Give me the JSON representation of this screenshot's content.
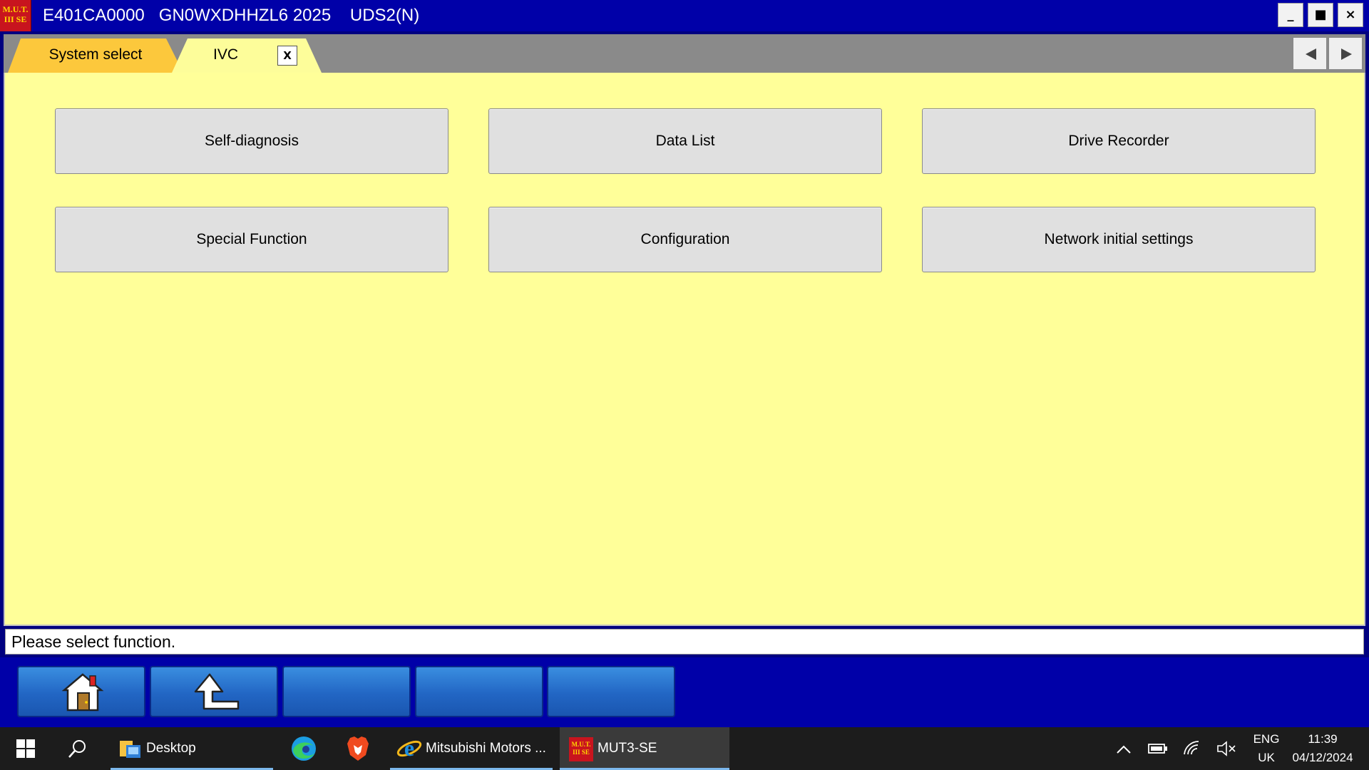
{
  "window": {
    "logo_text": "M.U.T.\nIII SE",
    "title": "E401CA0000   GN0WXDHHZL6 2025    UDS2(N)",
    "minimize_label": "_",
    "maximize_label": "■",
    "close_label": "×"
  },
  "tabs": [
    {
      "label": "System select",
      "active": false,
      "color": "#fcc83c"
    },
    {
      "label": "IVC",
      "active": true,
      "color": "#fdfd9a",
      "close_label": "X"
    }
  ],
  "main": {
    "background": "#ffff99",
    "function_buttons": [
      {
        "label": "Self-diagnosis"
      },
      {
        "label": "Data List"
      },
      {
        "label": "Drive Recorder"
      },
      {
        "label": "Special Function"
      },
      {
        "label": "Configuration"
      },
      {
        "label": "Network initial settings"
      }
    ]
  },
  "status": {
    "message": "Please select function."
  },
  "toolbar": {
    "buttons": [
      {
        "icon": "home-icon"
      },
      {
        "icon": "back-arrow-icon"
      },
      {
        "icon": ""
      },
      {
        "icon": ""
      },
      {
        "icon": ""
      }
    ]
  },
  "taskbar": {
    "items": [
      {
        "icon": "windows-start-icon",
        "label": ""
      },
      {
        "icon": "search-icon",
        "label": ""
      },
      {
        "icon": "folder-icon",
        "label": "Desktop"
      },
      {
        "icon": "edge-icon",
        "label": ""
      },
      {
        "icon": "brave-icon",
        "label": ""
      },
      {
        "icon": "internet-explorer-icon",
        "label": "Mitsubishi Motors ..."
      },
      {
        "icon": "mut3-icon",
        "label": "MUT3-SE"
      }
    ],
    "mini_logo_text": "M.U.T.\nIII SE",
    "tray": {
      "language": "ENG",
      "keyboard": "UK",
      "time": "11:39",
      "date": "04/12/2024"
    }
  },
  "colors": {
    "title_bar": "#0000a8",
    "accent_tab": "#fcc83c",
    "panel": "#ffff99",
    "toolbar_button": "#2266c4"
  }
}
